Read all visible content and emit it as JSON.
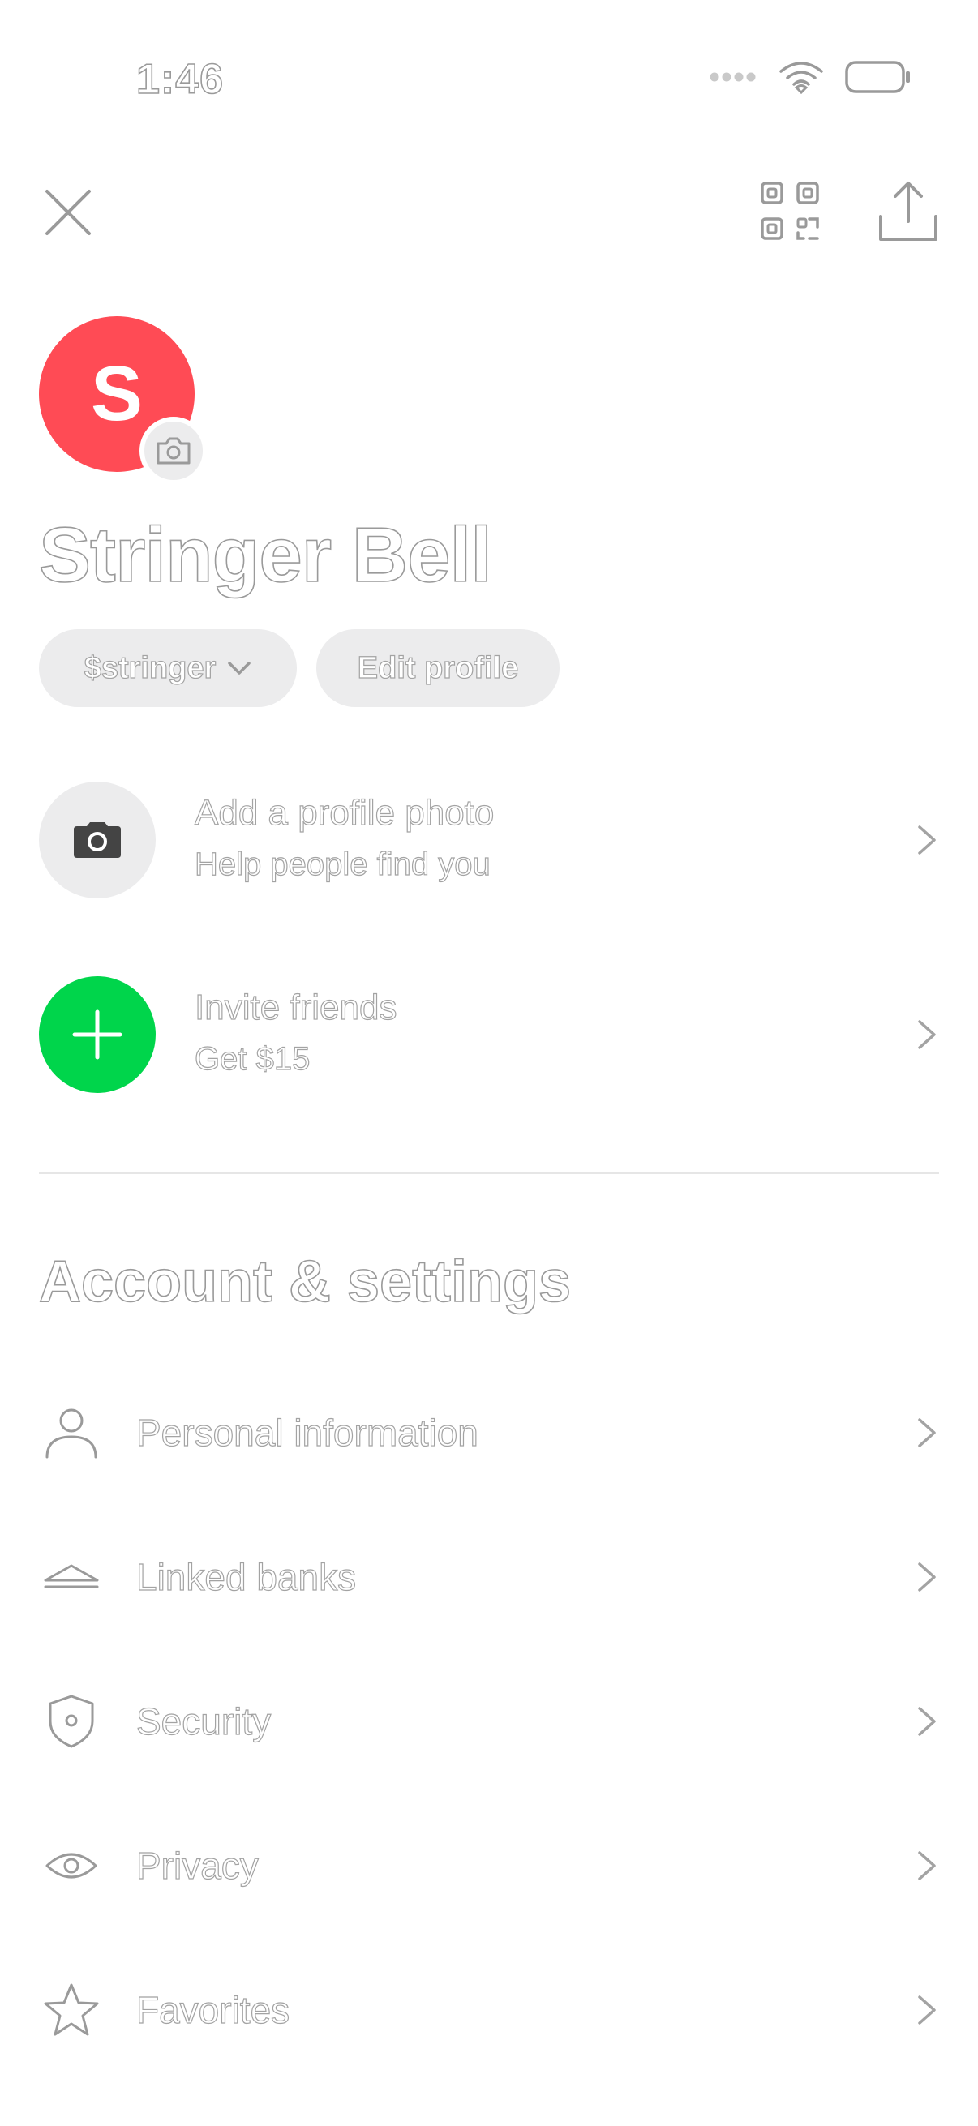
{
  "status_bar": {
    "time": "1:46"
  },
  "header": {
    "close_icon": "close-icon",
    "qr_icon": "qr-code-icon",
    "share_icon": "share-icon"
  },
  "profile": {
    "avatar_letter": "S",
    "avatar_color": "#ff4b55",
    "name": "Stringer Bell",
    "cashtag": "$stringer",
    "edit_label": "Edit profile"
  },
  "promos": [
    {
      "title": "Add a profile photo",
      "subtitle": "Help people find you",
      "icon": "camera-icon",
      "icon_bg": "#ececed"
    },
    {
      "title": "Invite friends",
      "subtitle": "Get $15",
      "icon": "plus-icon",
      "icon_bg": "#00d54b"
    }
  ],
  "settings": {
    "section_title": "Account & settings",
    "items": [
      {
        "label": "Personal information",
        "icon": "person-icon"
      },
      {
        "label": "Linked banks",
        "icon": "bank-icon"
      },
      {
        "label": "Security",
        "icon": "shield-icon"
      },
      {
        "label": "Privacy",
        "icon": "eye-icon"
      },
      {
        "label": "Favorites",
        "icon": "star-icon"
      }
    ]
  }
}
